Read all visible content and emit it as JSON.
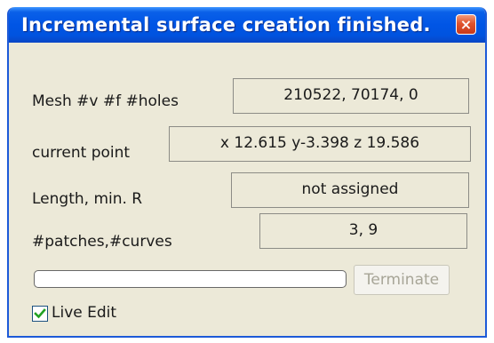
{
  "window": {
    "title": "Incremental surface creation finished.",
    "close_label": "×"
  },
  "fields": {
    "mesh": {
      "label": "Mesh #v #f #holes",
      "value": "210522, 70174, 0"
    },
    "current_point": {
      "label": "current point",
      "value": "x 12.615 y-3.398 z 19.586"
    },
    "length": {
      "label": "Length, min. R",
      "value": "not assigned"
    },
    "patches": {
      "label": "#patches,#curves",
      "value": "3, 9"
    }
  },
  "progress": {
    "percent": 0
  },
  "terminate_button": {
    "label": "Terminate",
    "enabled": false
  },
  "live_edit": {
    "label": "Live Edit",
    "checked": true
  },
  "colors": {
    "titlebar": "#0055e5",
    "dialog_bg": "#ece9d8",
    "checkmark": "#21a121",
    "disabled_text": "#a7a597"
  }
}
